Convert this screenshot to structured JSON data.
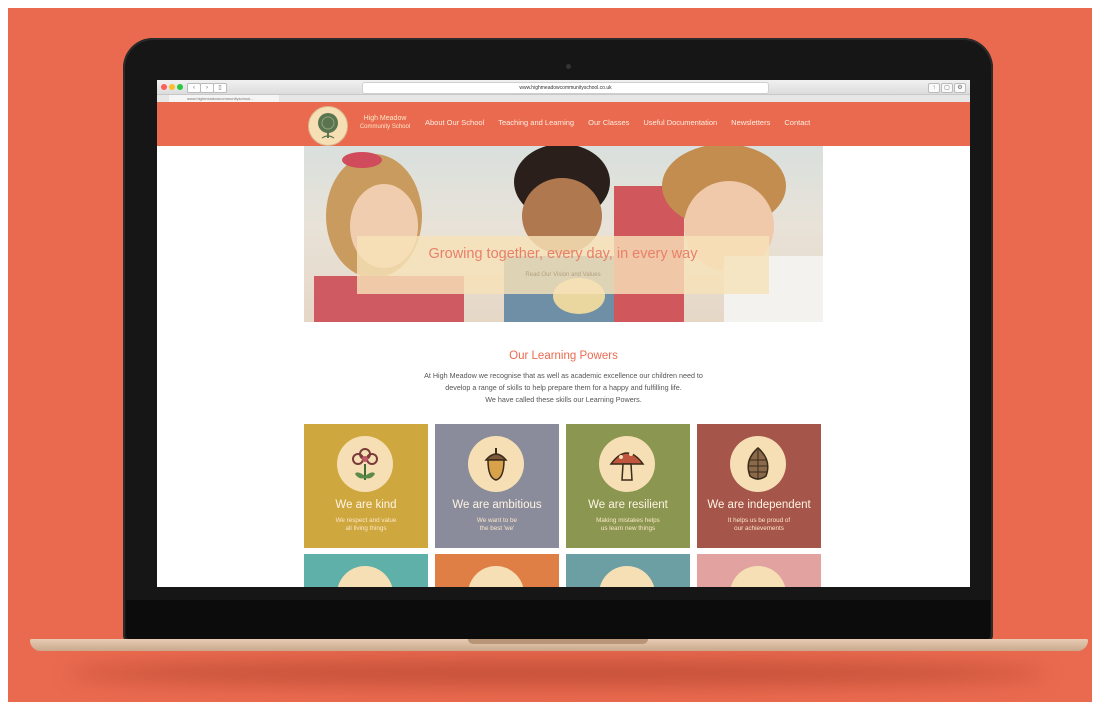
{
  "browser": {
    "url": "www.highmeadowcommunityschool.co.uk",
    "tab_url": "www.highmeadowcommunityschool..."
  },
  "site": {
    "logo_line1": "High Meadow",
    "logo_line2": "Community School",
    "nav": [
      "About Our School",
      "Teaching and Learning",
      "Our Classes",
      "Useful Documentation",
      "Newsletters",
      "Contact"
    ]
  },
  "hero": {
    "title": "Growing together, every day, in every way",
    "link": "Read Our Vision and Values"
  },
  "learning": {
    "title": "Our Learning Powers",
    "line1": "At High Meadow we recognise that as well as academic excellence our children need to",
    "line2": "develop a range of skills to help prepare them for a happy and fulfilling life.",
    "line3": "We have called these skills our Learning Powers."
  },
  "powers": [
    {
      "title": "We are kind",
      "sub1": "We respect and value",
      "sub2": "all living things",
      "color": "#cfa73f",
      "icon": "flower-icon"
    },
    {
      "title": "We are ambitious",
      "sub1": "We want to be",
      "sub2": "the best 'we'",
      "color": "#8a8c9c",
      "icon": "acorn-icon"
    },
    {
      "title": "We are resilient",
      "sub1": "Making mistakes helps",
      "sub2": "us learn new things",
      "color": "#8b9650",
      "icon": "mushroom-icon"
    },
    {
      "title": "We are independent",
      "sub1": "It helps us be proud of",
      "sub2": "our achievements",
      "color": "#a6554a",
      "icon": "pinecone-icon"
    }
  ],
  "powers_row2_colors": [
    "#5fb0a9",
    "#e07f45",
    "#6b9fa3",
    "#e2a3a0"
  ],
  "colors": {
    "brand": "#ea6a4f",
    "cream": "#f6dfb4"
  }
}
